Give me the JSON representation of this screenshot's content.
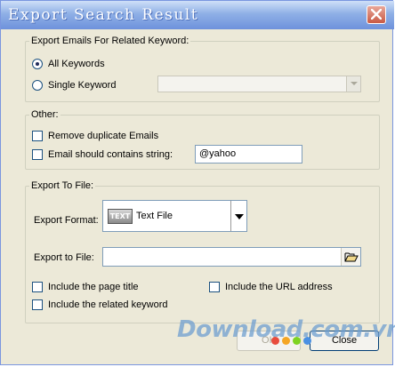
{
  "window": {
    "title": "Export Search Result"
  },
  "keyword_group": {
    "label": "Export Emails For Related Keyword:",
    "all_keywords_label": "All Keywords",
    "all_keywords_selected": true,
    "single_keyword_label": "Single Keyword",
    "single_keyword_value": ""
  },
  "other_group": {
    "label": "Other:",
    "remove_duplicates_label": "Remove duplicate Emails",
    "contains_string_label": "Email should contains string:",
    "contains_string_value": "@yahoo"
  },
  "export_group": {
    "label": "Export To File:",
    "format_label": "Export Format:",
    "format_icon_text": "TEXT",
    "format_value": "Text File",
    "file_label": "Export to File:",
    "file_value": "",
    "include_title_label": "Include the page title",
    "include_url_label": "Include the URL address",
    "include_keyword_label": "Include the related keyword"
  },
  "buttons": {
    "ok_label": "OK",
    "close_label": "Close"
  },
  "watermark": {
    "text": "Download.com.vn",
    "dot_colors": [
      "#e84c3d",
      "#f5a623",
      "#7ed321",
      "#4a90e2"
    ]
  },
  "icons": {
    "close": "close-icon",
    "browse": "open-folder-icon",
    "format": "text-file-icon"
  }
}
